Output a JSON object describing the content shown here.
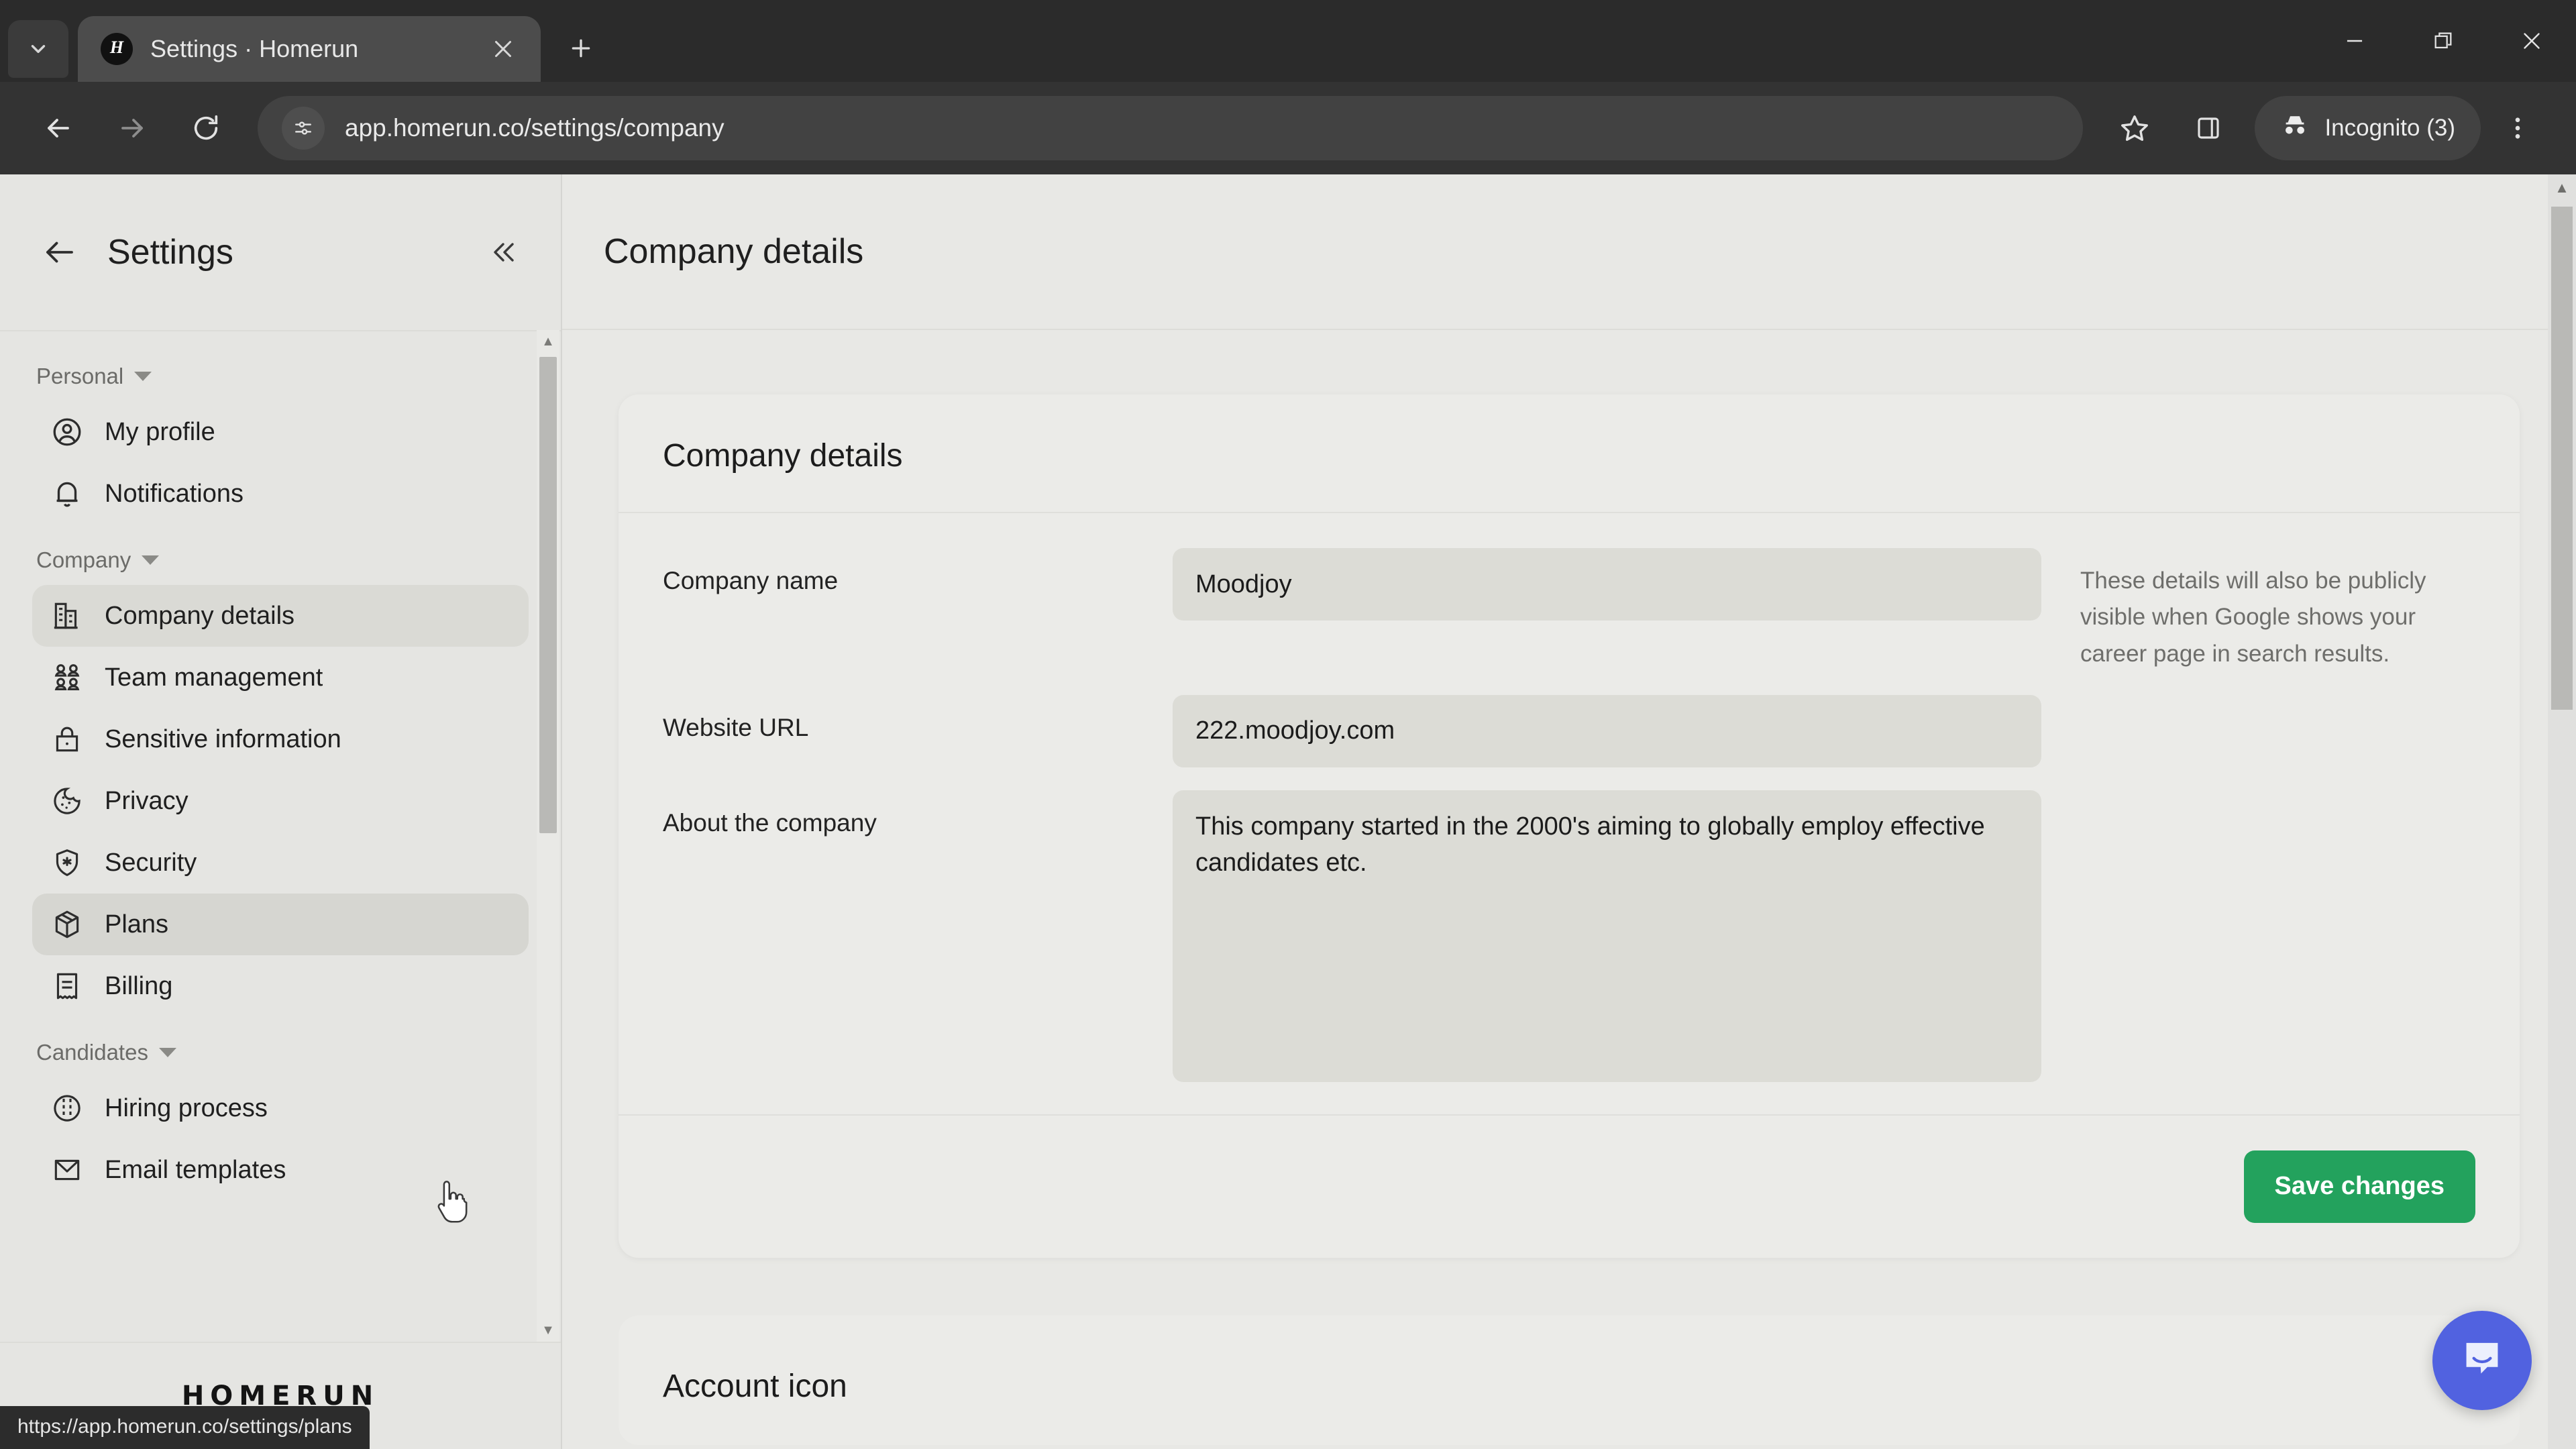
{
  "browser": {
    "tab": {
      "title": "Settings · Homerun",
      "favicon_letter": "H",
      "favicon_name": "homerun-favicon"
    },
    "tab_search_icon": "chevron-down-icon",
    "close_tab_icon": "close-icon",
    "new_tab_icon": "plus-icon",
    "window": {
      "minimize": "minimize-icon",
      "maximize": "restore-icon",
      "close": "window-close-icon"
    },
    "toolbar": {
      "back_icon": "back-arrow-icon",
      "forward_icon": "forward-arrow-icon",
      "reload_icon": "reload-icon",
      "site_settings_icon": "tune-icon",
      "url": "app.homerun.co/settings/company",
      "bookmark_icon": "star-icon",
      "side_panel_icon": "side-panel-icon",
      "profile_icon": "incognito-icon",
      "profile_label": "Incognito (3)",
      "menu_icon": "kebab-menu-icon"
    }
  },
  "sidebar": {
    "back_icon": "back-arrow-icon",
    "title": "Settings",
    "collapse_icon": "double-chevron-left-icon",
    "groups": [
      {
        "label": "Personal",
        "items": [
          {
            "label": "My profile",
            "icon": "user-circle-icon"
          },
          {
            "label": "Notifications",
            "icon": "bell-icon"
          }
        ]
      },
      {
        "label": "Company",
        "items": [
          {
            "label": "Company details",
            "icon": "building-icon",
            "state": "active"
          },
          {
            "label": "Team management",
            "icon": "people-icon"
          },
          {
            "label": "Sensitive information",
            "icon": "lock-icon"
          },
          {
            "label": "Privacy",
            "icon": "cookie-icon"
          },
          {
            "label": "Security",
            "icon": "shield-star-icon"
          },
          {
            "label": "Plans",
            "icon": "box-icon",
            "state": "hover"
          },
          {
            "label": "Billing",
            "icon": "receipt-icon"
          }
        ]
      },
      {
        "label": "Candidates",
        "items": [
          {
            "label": "Hiring process",
            "icon": "flow-circle-icon"
          },
          {
            "label": "Email templates",
            "icon": "envelope-icon"
          }
        ]
      }
    ],
    "logo": "HOMERUN"
  },
  "main": {
    "header_title": "Company details",
    "card": {
      "title": "Company details",
      "fields": [
        {
          "label": "Company name",
          "value": "Moodjoy",
          "type": "input"
        },
        {
          "label": "Website URL",
          "value": "222.moodjoy.com",
          "type": "input"
        },
        {
          "label": "About the company",
          "value": "This company started in the 2000's aiming to globally employ effective candidates etc.",
          "type": "textarea"
        }
      ],
      "help_text": "These details will also be publicly visible when Google shows your career page in search results.",
      "save_label": "Save changes"
    },
    "card2": {
      "title": "Account icon"
    }
  },
  "widgets": {
    "intercom_icon": "messenger-icon",
    "status_url": "https://app.homerun.co/settings/plans",
    "cursor_icon": "pointer-cursor-icon"
  },
  "colors": {
    "accent_green": "#23a25d",
    "intercom_blue": "#5162e0"
  }
}
